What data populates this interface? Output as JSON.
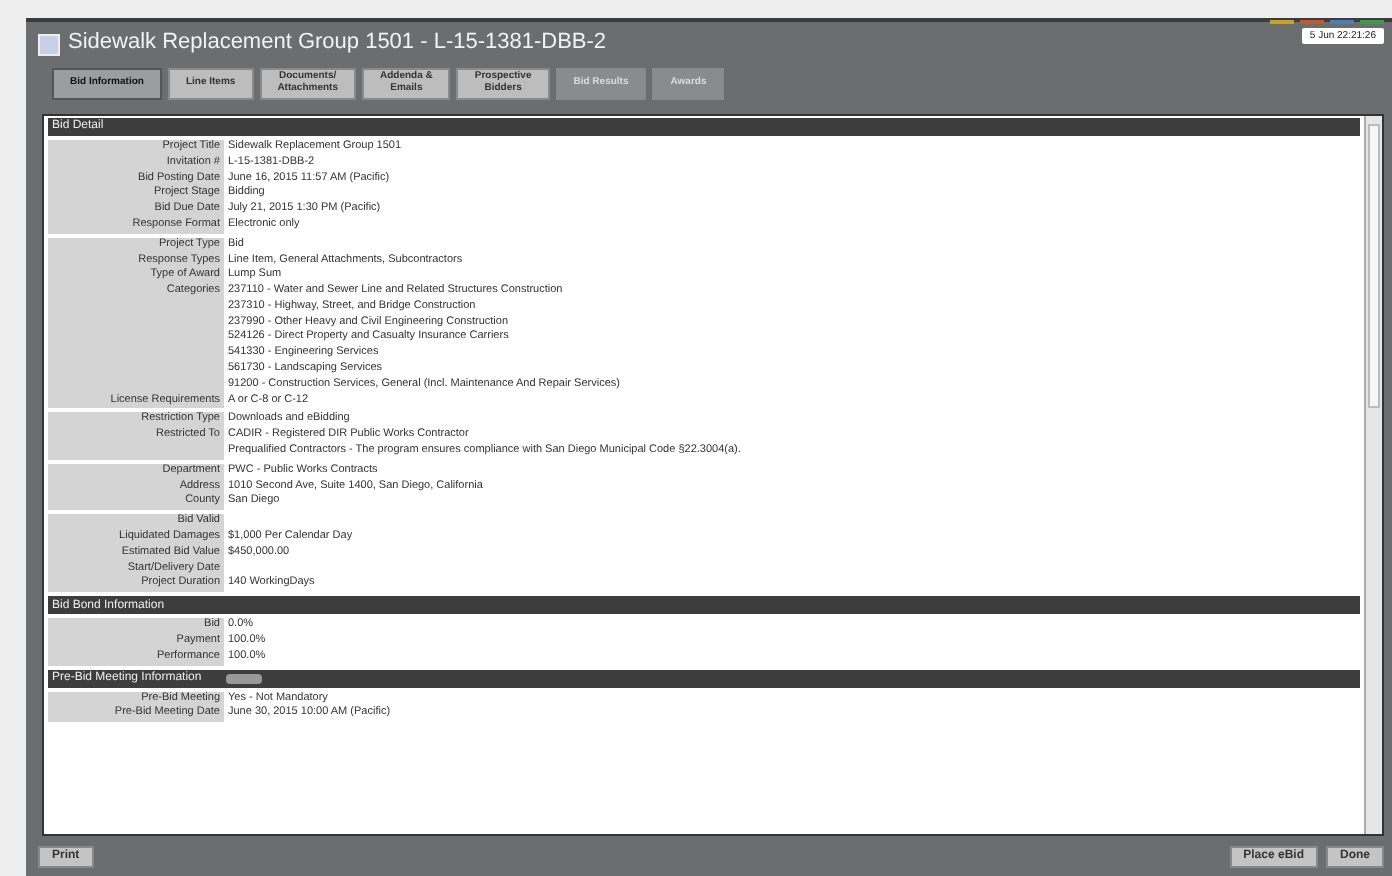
{
  "window": {
    "title": "Sidewalk Replacement Group 1501  -  L-15-1381-DBB-2",
    "clock": "5 Jun 22:21:26"
  },
  "status_lights": [
    {
      "color": "#c9a227"
    },
    {
      "color": "#c4582a"
    },
    {
      "color": "#4a7fb5"
    },
    {
      "color": "#3f9a4a"
    }
  ],
  "tabs": [
    {
      "label": "Bid Information",
      "selected": true,
      "disabled": false
    },
    {
      "label": "Line Items",
      "selected": false,
      "disabled": false
    },
    {
      "label": "Documents/\nAttachments",
      "selected": false,
      "disabled": false
    },
    {
      "label": "Addenda &\nEmails",
      "selected": false,
      "disabled": false
    },
    {
      "label": "Prospective\nBidders",
      "selected": false,
      "disabled": false
    },
    {
      "label": "Bid Results",
      "selected": false,
      "disabled": true
    },
    {
      "label": "Awards",
      "selected": false,
      "disabled": true
    }
  ],
  "sections": [
    {
      "title": "Bid Detail",
      "groups": [
        [
          {
            "label": "Project Title",
            "lines": [
              "Sidewalk Replacement Group 1501"
            ]
          },
          {
            "label": "Invitation #",
            "lines": [
              "L-15-1381-DBB-2"
            ]
          },
          {
            "label": "Bid Posting Date",
            "lines": [
              "June 16, 2015  11:57 AM (Pacific)"
            ]
          },
          {
            "label": "Project Stage",
            "lines": [
              "Bidding"
            ]
          },
          {
            "label": "Bid Due Date",
            "lines": [
              "July 21, 2015  1:30 PM (Pacific)"
            ]
          },
          {
            "label": "Response Format",
            "lines": [
              "Electronic only"
            ]
          }
        ],
        [
          {
            "label": "Project Type",
            "lines": [
              "Bid"
            ]
          },
          {
            "label": "Response Types",
            "lines": [
              "Line Item, General Attachments, Subcontractors"
            ]
          },
          {
            "label": "Type of Award",
            "lines": [
              "Lump Sum"
            ]
          },
          {
            "label": "Categories",
            "lines": [
              "237110 - Water and Sewer Line and Related Structures Construction",
              "237310 - Highway, Street, and Bridge Construction",
              "237990 - Other Heavy and Civil Engineering Construction",
              "524126 - Direct Property and Casualty Insurance Carriers",
              "541330 - Engineering Services",
              "561730 - Landscaping Services",
              "91200 - Construction Services, General (Incl. Maintenance And Repair Services)"
            ]
          },
          {
            "label": "License Requirements",
            "lines": [
              "A or C-8 or C-12"
            ]
          }
        ],
        [
          {
            "label": "Restriction Type",
            "lines": [
              "Downloads and eBidding"
            ]
          },
          {
            "label": "Restricted To",
            "lines": [
              "CADIR - Registered DIR Public Works Contractor",
              "Prequalified Contractors - The program ensures compliance with San Diego Municipal Code §22.3004(a)."
            ]
          }
        ],
        [
          {
            "label": "Department",
            "lines": [
              "PWC - Public Works Contracts"
            ]
          },
          {
            "label": "Address",
            "lines": [
              "1010 Second Ave, Suite 1400, San Diego, California"
            ]
          },
          {
            "label": "County",
            "lines": [
              "San Diego"
            ]
          }
        ],
        [
          {
            "label": "Bid Valid"
          },
          {
            "label": "Liquidated Damages",
            "lines": [
              "$1,000 Per Calendar Day"
            ]
          },
          {
            "label": "Estimated Bid Value",
            "lines": [
              "$450,000.00"
            ]
          },
          {
            "label": "Start/Delivery Date"
          },
          {
            "label": "Project Duration",
            "lines": [
              "140 WorkingDays"
            ]
          }
        ]
      ]
    },
    {
      "title": "Bid Bond Information",
      "groups": [
        [
          {
            "label": "Bid",
            "lines": [
              "0.0%"
            ]
          },
          {
            "label": "Payment",
            "lines": [
              "100.0%"
            ]
          },
          {
            "label": "Performance",
            "lines": [
              "100.0%"
            ]
          }
        ]
      ]
    },
    {
      "title": "Pre-Bid Meeting Information",
      "has_toggle": true,
      "groups": [
        [
          {
            "label": "Pre-Bid Meeting",
            "lines": [
              "Yes - Not Mandatory"
            ]
          },
          {
            "label": "Pre-Bid Meeting Date",
            "lines": [
              "June 30, 2015  10:00 AM (Pacific)"
            ]
          }
        ]
      ]
    }
  ],
  "buttons_left": [
    "Print"
  ],
  "buttons_right": [
    "Place eBid",
    "Done"
  ]
}
